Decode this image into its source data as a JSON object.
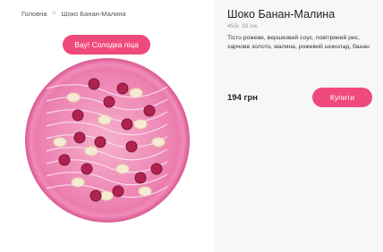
{
  "breadcrumb": {
    "home": "Головна",
    "separator": ">",
    "current": "Шоко Банан-Малина"
  },
  "product": {
    "badge": "Вау! Солодка піца",
    "title": "Шоко Банан-Малина",
    "weight": "455г. 30 см.",
    "description": "Тісто рожеве, вершковий соус, повітряний рис, харчове золото, малина, рожевий шоколад, банан",
    "price": "194 грн",
    "buy_label": "Купити"
  },
  "colors": {
    "accent": "#f04a7d",
    "right_panel_bg": "#f7f7f7"
  }
}
